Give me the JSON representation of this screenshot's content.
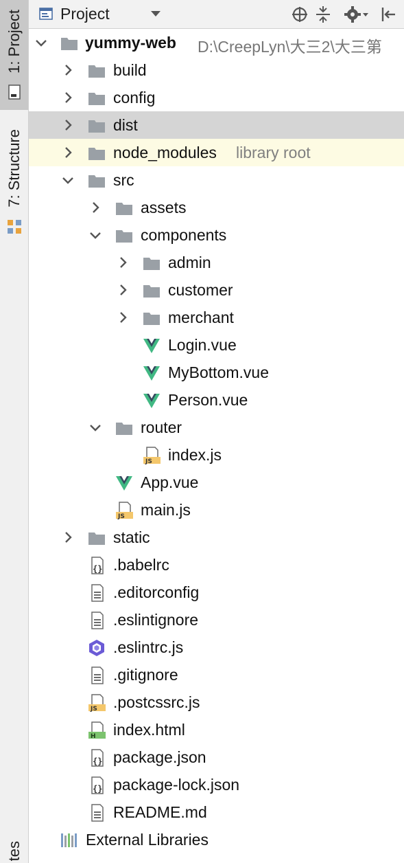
{
  "toolwindow": {
    "title": "Project",
    "tabs": [
      {
        "label": "1: Project"
      },
      {
        "label": "7: Structure"
      },
      {
        "label": "tes"
      }
    ]
  },
  "tree": {
    "root": {
      "label": "yummy-web",
      "path": "D:\\CreepLyn\\大三2\\大三第"
    },
    "items": [
      {
        "label": "build"
      },
      {
        "label": "config"
      },
      {
        "label": "dist"
      },
      {
        "label": "node_modules",
        "suffix": "library root"
      },
      {
        "label": "src"
      },
      {
        "label": "assets"
      },
      {
        "label": "components"
      },
      {
        "label": "admin"
      },
      {
        "label": "customer"
      },
      {
        "label": "merchant"
      },
      {
        "label": "Login.vue"
      },
      {
        "label": "MyBottom.vue"
      },
      {
        "label": "Person.vue"
      },
      {
        "label": "router"
      },
      {
        "label": "index.js"
      },
      {
        "label": "App.vue"
      },
      {
        "label": "main.js"
      },
      {
        "label": "static"
      },
      {
        "label": ".babelrc"
      },
      {
        "label": ".editorconfig"
      },
      {
        "label": ".eslintignore"
      },
      {
        "label": ".eslintrc.js"
      },
      {
        "label": ".gitignore"
      },
      {
        "label": ".postcssrc.js"
      },
      {
        "label": "index.html"
      },
      {
        "label": "package.json"
      },
      {
        "label": "package-lock.json"
      },
      {
        "label": "README.md"
      },
      {
        "label": "External Libraries"
      }
    ]
  },
  "icons": {
    "folder": "folder-icon",
    "vue": "vue-file-icon",
    "js": "js-file-icon",
    "json": "json-file-icon",
    "text": "text-file-icon",
    "eslint": "eslint-icon",
    "html": "html-file-icon",
    "libraries": "libraries-icon"
  },
  "colors": {
    "selected_row": "#d5d5d5",
    "library_root_row": "#fdfbe3",
    "folder": "#9aa0a6",
    "vue_green": "#41b883",
    "vue_dark": "#35495e",
    "js_badge": "#f4c76b",
    "eslint": "#6b5bd6",
    "html_badge": "#7cc36e"
  }
}
